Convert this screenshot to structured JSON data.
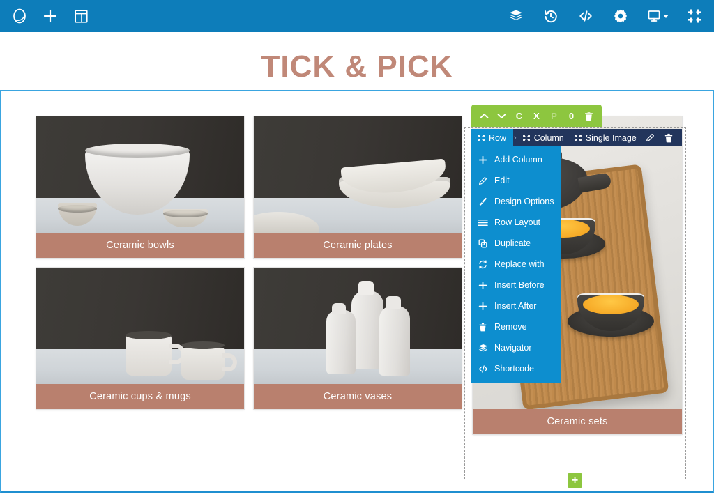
{
  "topbar": {
    "left_items": [
      {
        "name": "logo-icon",
        "label": "Logo"
      },
      {
        "name": "add-element-icon",
        "label": "Add Element"
      },
      {
        "name": "templates-icon",
        "label": "Templates"
      }
    ],
    "right_items": [
      {
        "name": "navigator-icon",
        "label": "Navigator"
      },
      {
        "name": "history-icon",
        "label": "History"
      },
      {
        "name": "code-icon",
        "label": "Custom CSS / Code"
      },
      {
        "name": "settings-icon",
        "label": "Settings"
      },
      {
        "name": "responsive-icon",
        "label": "Responsive View"
      },
      {
        "name": "collapse-icon",
        "label": "Collapse"
      }
    ],
    "background": "#0d7dba"
  },
  "page": {
    "title": "TICK & PICK",
    "title_color": "#c08878",
    "caption_color": "#b9806e",
    "frame_border_color": "#3aa5e0"
  },
  "gallery": {
    "rows": [
      [
        {
          "caption": "Ceramic bowls",
          "scene": "bowls"
        },
        {
          "caption": "Ceramic plates",
          "scene": "plates"
        }
      ],
      [
        {
          "caption": "Ceramic cups & mugs",
          "scene": "mugs"
        },
        {
          "caption": "Ceramic vases",
          "scene": "vases"
        }
      ]
    ],
    "tall_card": {
      "caption": "Ceramic sets",
      "scene": "tea-set"
    }
  },
  "element_toolbar": {
    "background": "#8dc63f",
    "buttons": [
      {
        "name": "move-up-button",
        "label": "⌃",
        "dim": false
      },
      {
        "name": "move-down-button",
        "label": "⌄",
        "dim": false
      },
      {
        "name": "copy-button",
        "label": "C",
        "dim": false
      },
      {
        "name": "cut-button",
        "label": "X",
        "dim": false
      },
      {
        "name": "paste-button",
        "label": "P",
        "dim": true
      },
      {
        "name": "clone-count",
        "label": "0",
        "dim": false
      },
      {
        "name": "delete-button",
        "label": "trash",
        "dim": false
      }
    ]
  },
  "breadcrumb": {
    "active": {
      "label": "Row",
      "color": "#0d8ecf"
    },
    "separator": "›",
    "items": [
      {
        "label": "Column"
      },
      {
        "label": "Single Image"
      }
    ],
    "actions": [
      {
        "name": "edit-pencil-icon",
        "label": "Edit"
      },
      {
        "name": "delete-trash-icon",
        "label": "Delete"
      }
    ],
    "rest_background": "#22355c"
  },
  "context_menu": {
    "background": "#0d8ecf",
    "items": [
      {
        "label": "Add Column",
        "icon": "plus-icon"
      },
      {
        "label": "Edit",
        "icon": "pencil-icon"
      },
      {
        "label": "Design Options",
        "icon": "brush-icon"
      },
      {
        "label": "Row Layout",
        "icon": "layout-lines-icon"
      },
      {
        "label": "Duplicate",
        "icon": "duplicate-icon"
      },
      {
        "label": "Replace with",
        "icon": "replace-icon"
      },
      {
        "label": "Insert Before",
        "icon": "plus-icon"
      },
      {
        "label": "Insert After",
        "icon": "plus-icon"
      },
      {
        "label": "Remove",
        "icon": "trash-icon"
      },
      {
        "label": "Navigator",
        "icon": "layers-icon"
      },
      {
        "label": "Shortcode",
        "icon": "code-icon"
      }
    ]
  },
  "selection": {
    "add_row_label": "+",
    "add_row_color": "#8dc63f",
    "outline_style": "dashed"
  }
}
